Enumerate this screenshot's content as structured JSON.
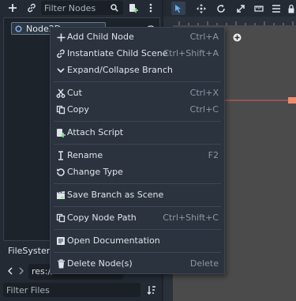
{
  "scene_dock": {
    "filter_placeholder": "Filter Nodes",
    "tree": {
      "root_node": "Node2D"
    }
  },
  "filesystem_dock": {
    "title": "FileSystem",
    "path": "res://",
    "filter_placeholder": "Filter Files"
  },
  "context_menu": {
    "items": [
      {
        "label": "Add Child Node",
        "shortcut": "Ctrl+A",
        "icon": "add-icon"
      },
      {
        "label": "Instantiate Child Scene",
        "shortcut": "Ctrl+Shift+A",
        "icon": "link-icon"
      },
      {
        "label": "Expand/Collapse Branch",
        "shortcut": "",
        "icon": "chevron-down-icon"
      },
      {
        "label": "Cut",
        "shortcut": "Ctrl+X",
        "icon": "scissors-icon"
      },
      {
        "label": "Copy",
        "shortcut": "Ctrl+C",
        "icon": "copy-icon"
      },
      {
        "label": "Attach Script",
        "shortcut": "",
        "icon": "script-icon"
      },
      {
        "label": "Rename",
        "shortcut": "F2",
        "icon": "text-cursor-icon"
      },
      {
        "label": "Change Type",
        "shortcut": "",
        "icon": "rotate-icon"
      },
      {
        "label": "Save Branch as Scene",
        "shortcut": "",
        "icon": "clapperboard-icon"
      },
      {
        "label": "Copy Node Path",
        "shortcut": "Ctrl+Shift+C",
        "icon": "copy-path-icon"
      },
      {
        "label": "Open Documentation",
        "shortcut": "",
        "icon": "help-icon"
      },
      {
        "label": "Delete Node(s)",
        "shortcut": "Delete",
        "icon": "trash-icon"
      }
    ]
  },
  "colors": {
    "accent": "#5fb2ff",
    "menu_bg": "#2b333e",
    "viewport_bg": "#4b4b4b",
    "axis_red": "#e05a5a",
    "script_green": "#8eef97"
  }
}
